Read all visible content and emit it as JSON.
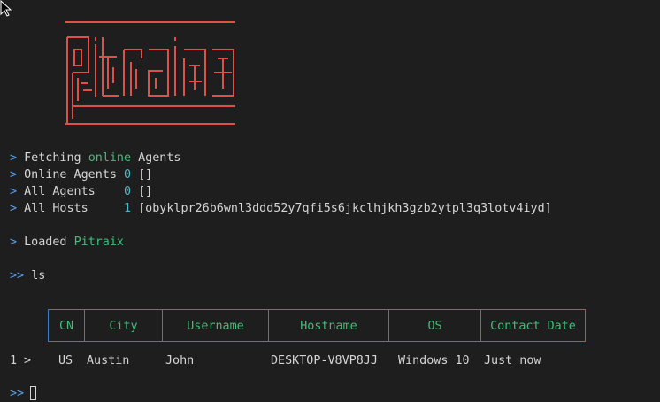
{
  "logo": {
    "text": "pitraix",
    "color": "#e0504a"
  },
  "lines": {
    "fetching": {
      "prefix": ">",
      "before": "Fetching ",
      "highlight": "online",
      "after": " Agents"
    },
    "online_agents": {
      "prefix": ">",
      "label": "Online Agents",
      "count": "0",
      "list": "[]"
    },
    "all_agents": {
      "prefix": ">",
      "label": "All Agents",
      "count": "0",
      "list": "[]"
    },
    "all_hosts": {
      "prefix": ">",
      "label": "All Hosts",
      "count": "1",
      "list": "[obyklpr26b6wnl3ddd52y7qfi5s6jkclhjkh3gzb2ytpl3q3lotv4iyd]"
    },
    "loaded": {
      "prefix": ">",
      "before": "Loaded ",
      "highlight": "Pitraix"
    },
    "command": {
      "prompt": ">>",
      "text": "ls"
    }
  },
  "table": {
    "columns": [
      "CN",
      "City",
      "Username",
      "Hostname",
      "OS",
      "Contact Date"
    ],
    "rows": [
      {
        "index": "1",
        "marker": ">",
        "cells": [
          "US",
          "Austin",
          "John",
          "DESKTOP-V8VP8JJ",
          "Windows 10",
          "Just now"
        ]
      }
    ]
  },
  "input_prompt": ">>",
  "colors": {
    "prompt": "#5aa0e6",
    "highlight": "#3fbd7a",
    "number": "#4fb8c4",
    "border": "#3a7cc7",
    "background": "#1e1e1e"
  }
}
